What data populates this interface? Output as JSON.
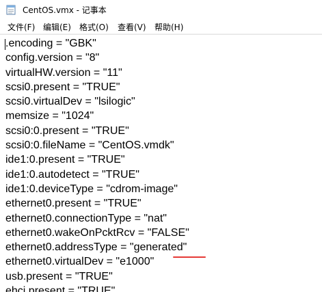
{
  "window": {
    "title": "CentOS.vmx - 记事本"
  },
  "menu": {
    "items": [
      {
        "label": "文件(F)"
      },
      {
        "label": "编辑(E)"
      },
      {
        "label": "格式(O)"
      },
      {
        "label": "查看(V)"
      },
      {
        "label": "帮助(H)"
      }
    ]
  },
  "editor": {
    "lines": [
      ".encoding = \"GBK\"",
      "config.version = \"8\"",
      "virtualHW.version = \"11\"",
      "scsi0.present = \"TRUE\"",
      "scsi0.virtualDev = \"lsilogic\"",
      "memsize = \"1024\"",
      "scsi0:0.present = \"TRUE\"",
      "scsi0:0.fileName = \"CentOS.vmdk\"",
      "ide1:0.present = \"TRUE\"",
      "ide1:0.autodetect = \"TRUE\"",
      "ide1:0.deviceType = \"cdrom-image\"",
      "ethernet0.present = \"TRUE\"",
      "ethernet0.connectionType = \"nat\"",
      "ethernet0.wakeOnPcktRcv = \"FALSE\"",
      "ethernet0.addressType = \"generated\"",
      "ethernet0.virtualDev = \"e1000\"",
      "usb.present = \"TRUE\"",
      "ehci.present = \"TRUE\""
    ],
    "annotation_color": "#e53935"
  }
}
